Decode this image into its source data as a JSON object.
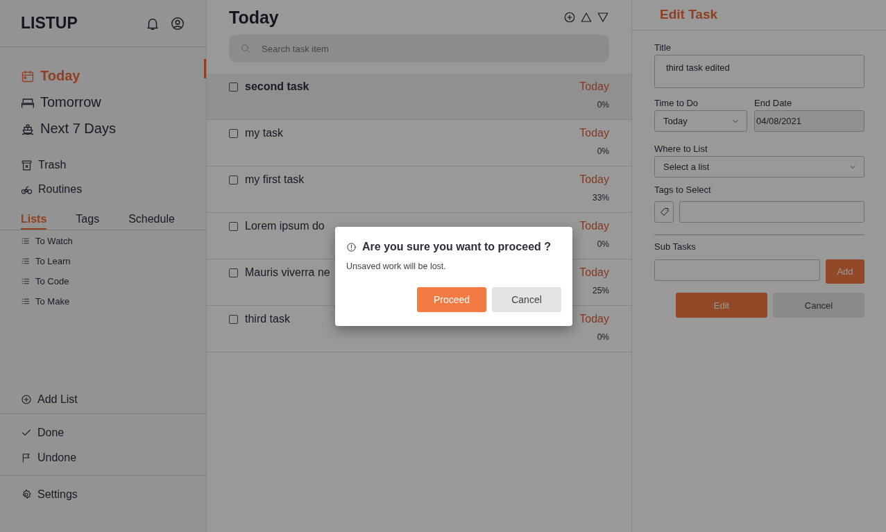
{
  "sidebar": {
    "logo": "LISTUP",
    "nav": [
      {
        "label": "Today",
        "selected": true
      },
      {
        "label": "Tomorrow",
        "selected": false
      },
      {
        "label": "Next 7 Days",
        "selected": false
      }
    ],
    "secondary": [
      "Trash",
      "Routines"
    ],
    "tabs": [
      {
        "label": "Lists",
        "selected": true
      },
      {
        "label": "Tags",
        "selected": false
      },
      {
        "label": "Schedule",
        "selected": false
      }
    ],
    "lists": [
      "To Watch",
      "To Learn",
      "To Code",
      "To Make"
    ],
    "add_list": "Add List",
    "filters": [
      "Done",
      "Undone"
    ],
    "settings": "Settings"
  },
  "main": {
    "title": "Today",
    "search": {
      "placeholder": "Search task item"
    },
    "tasks": [
      {
        "title": "second task",
        "due": "Today",
        "progress": "0%",
        "checked": false,
        "selected": true
      },
      {
        "title": "my task",
        "due": "Today",
        "progress": "0%",
        "checked": false,
        "selected": false
      },
      {
        "title": "my first task",
        "due": "Today",
        "progress": "33%",
        "checked": false,
        "selected": false
      },
      {
        "title": "Lorem ipsum do",
        "due": "Today",
        "progress": "0%",
        "checked": false,
        "selected": false
      },
      {
        "title": "Mauris viverra ne",
        "due": "Today",
        "progress": "25%",
        "checked": false,
        "selected": false
      },
      {
        "title": "third task",
        "due": "Today",
        "progress": "0%",
        "checked": false,
        "selected": false
      }
    ]
  },
  "edit_panel": {
    "heading": "Edit Task",
    "title_label": "Title",
    "title_value": "third task edited",
    "time_label": "Time to Do",
    "time_value": "Today",
    "end_label": "End Date",
    "end_value": "04/08/2021",
    "list_label": "Where to List",
    "list_value": "Select a list",
    "tags_label": "Tags to Select",
    "subtasks_label": "Sub Tasks",
    "add_button": "Add",
    "edit_button": "Edit",
    "cancel_button": "Cancel"
  },
  "dialog": {
    "title": "Are you sure you want to proceed ?",
    "message": "Unsaved work will be lost.",
    "confirm": "Proceed",
    "cancel": "Cancel"
  }
}
